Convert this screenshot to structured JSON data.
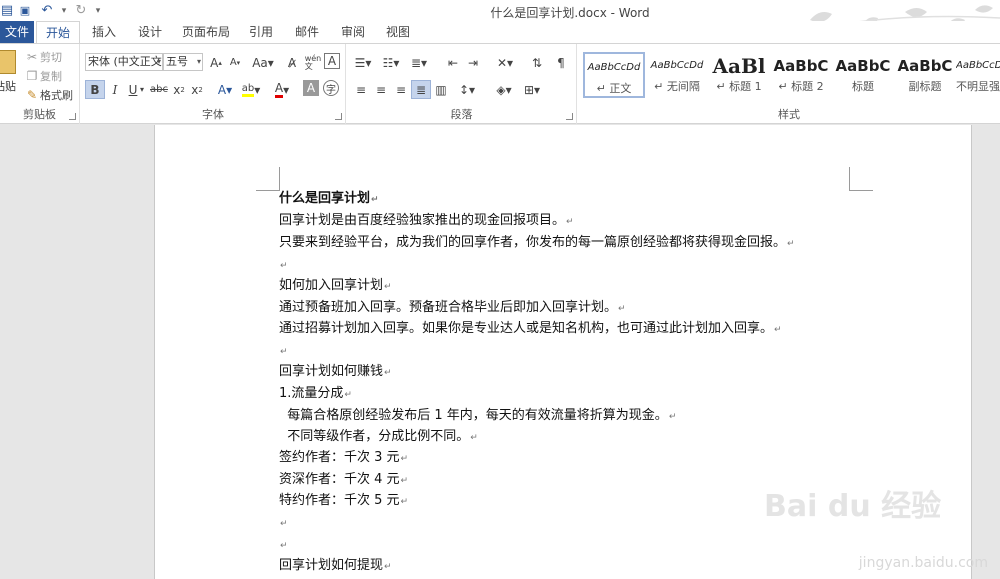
{
  "window": {
    "title": "什么是回享计划.docx - Word"
  },
  "tabs": [
    {
      "label": "文件"
    },
    {
      "label": "开始"
    },
    {
      "label": "插入"
    },
    {
      "label": "设计"
    },
    {
      "label": "页面布局"
    },
    {
      "label": "引用"
    },
    {
      "label": "邮件"
    },
    {
      "label": "审阅"
    },
    {
      "label": "视图"
    }
  ],
  "clipboard": {
    "paste": "粘贴",
    "cut": "剪切",
    "copy": "复制",
    "format_painter": "格式刷",
    "group": "剪贴板"
  },
  "font": {
    "name": "宋体 (中文正文)",
    "size": "五号",
    "group": "字体"
  },
  "paragraph": {
    "group": "段落"
  },
  "styles": {
    "group": "样式",
    "items": [
      {
        "sample": "AaBbCcDd",
        "name": "正文"
      },
      {
        "sample": "AaBbCcDd",
        "name": "无间隔"
      },
      {
        "sample": "AaBl",
        "name": "标题 1"
      },
      {
        "sample": "AaBbC",
        "name": "标题 2"
      },
      {
        "sample": "AaBbC",
        "name": "标题"
      },
      {
        "sample": "AaBbC",
        "name": "副标题"
      },
      {
        "sample": "AaBbCcDd",
        "name": "不明显强调"
      }
    ]
  },
  "document": {
    "lines": [
      {
        "text": "什么是回享计划"
      },
      {
        "text": "回享计划是由百度经验独家推出的现金回报项目。"
      },
      {
        "text": "只要来到经验平台，成为我们的回享作者，你发布的每一篇原创经验都将获得现金回报。"
      },
      {
        "text": ""
      },
      {
        "text": "如何加入回享计划"
      },
      {
        "text": "通过预备班加入回享。预备班合格毕业后即加入回享计划。"
      },
      {
        "text": "通过招募计划加入回享。如果你是专业达人或是知名机构，也可通过此计划加入回享。"
      },
      {
        "text": ""
      },
      {
        "text": "回享计划如何赚钱"
      },
      {
        "text": "1.流量分成"
      },
      {
        "text": "  每篇合格原创经验发布后 1 年内，每天的有效流量将折算为现金。"
      },
      {
        "text": "  不同等级作者，分成比例不同。"
      },
      {
        "text": "签约作者：千次 3 元"
      },
      {
        "text": "资深作者：千次 4 元"
      },
      {
        "text": "特约作者：千次 5 元"
      },
      {
        "text": ""
      },
      {
        "text": ""
      },
      {
        "text": "回享计划如何提现"
      }
    ],
    "paragraph_mark": "↵"
  },
  "watermark": {
    "brand": "Bai du 经验",
    "url": "jingyan.baidu.com"
  }
}
